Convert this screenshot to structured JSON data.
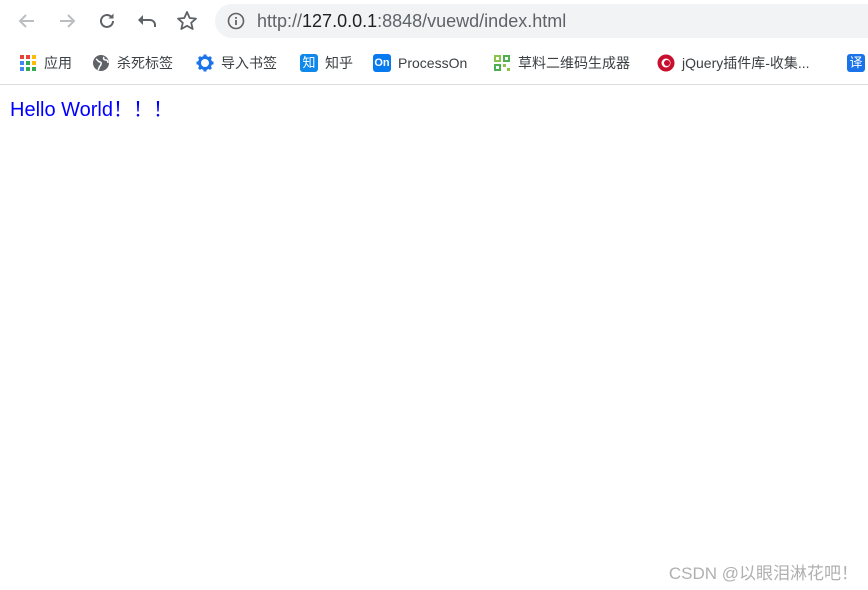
{
  "browser": {
    "url_prefix": "http://",
    "url_host": "127.0.0.1",
    "url_rest": ":8848/vuewd/index.html"
  },
  "bookmarks": [
    {
      "label": "应用",
      "icon": "apps-grid-icon"
    },
    {
      "label": "杀死标签",
      "icon": "globe-icon"
    },
    {
      "label": "导入书签",
      "icon": "gear-icon"
    },
    {
      "label": "知乎",
      "icon": "zhihu-icon"
    },
    {
      "label": "ProcessOn",
      "icon": "processon-icon"
    },
    {
      "label": "草料二维码生成器",
      "icon": "qrcode-icon"
    },
    {
      "label": "jQuery插件库-收集...",
      "icon": "jquery-icon"
    },
    {
      "label": "",
      "icon": "translate-icon",
      "icon_text": "译"
    }
  ],
  "page": {
    "text": "Hello World！！！",
    "text_color": "#0000ff"
  },
  "watermark": "CSDN @以眼泪淋花吧！",
  "icon_labels": {
    "zhihu": "知",
    "processon": "On"
  }
}
